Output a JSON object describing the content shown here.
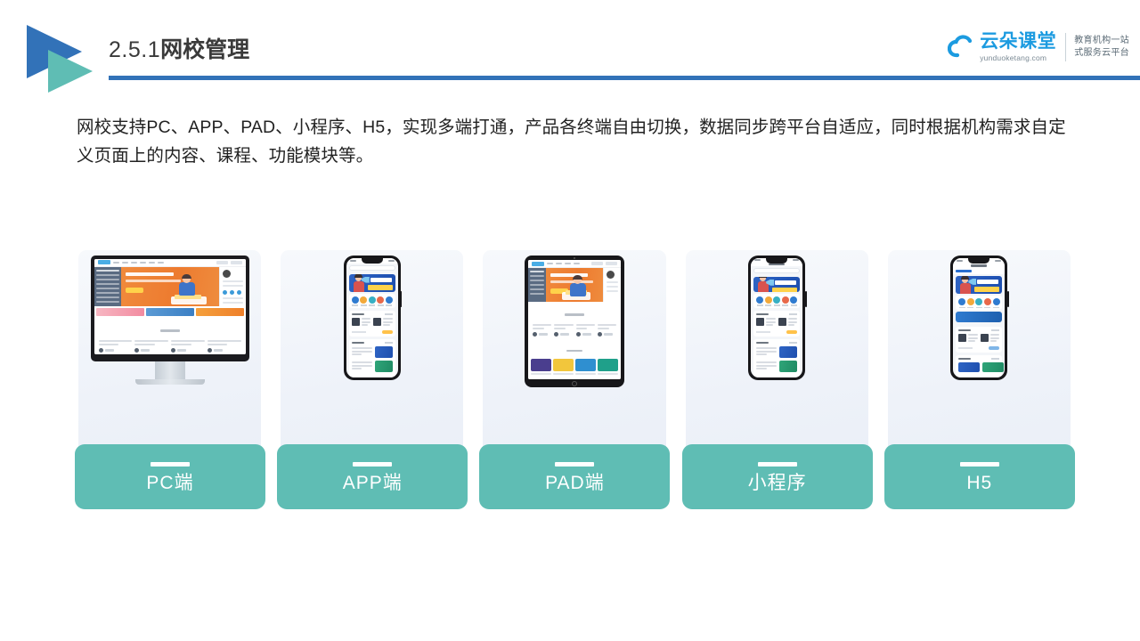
{
  "header": {
    "section_number": "2.5.1",
    "section_title": "网校管理",
    "accent_blue": "#3272B8",
    "accent_teal": "#5FBDB4"
  },
  "brand": {
    "name": "云朵课堂",
    "url": "yunduoketang.com",
    "tagline_line1": "教育机构一站",
    "tagline_line2": "式服务云平台",
    "logo_color": "#1C9BE0"
  },
  "body": {
    "paragraph": "网校支持PC、APP、PAD、小程序、H5，实现多端打通，产品各终端自由切换，数据同步跨平台自适应，同时根据机构需求自定义页面上的内容、课程、功能模块等。"
  },
  "cards": [
    {
      "label": "PC端",
      "device": "desktop-monitor"
    },
    {
      "label": "APP端",
      "device": "smartphone"
    },
    {
      "label": "PAD端",
      "device": "tablet"
    },
    {
      "label": "小程序",
      "device": "smartphone"
    },
    {
      "label": "H5",
      "device": "smartphone"
    }
  ]
}
